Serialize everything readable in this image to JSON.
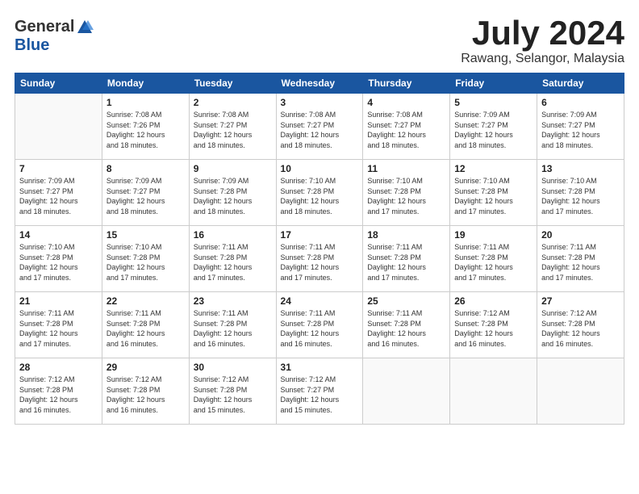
{
  "logo": {
    "general": "General",
    "blue": "Blue"
  },
  "title": "July 2024",
  "location": "Rawang, Selangor, Malaysia",
  "headers": [
    "Sunday",
    "Monday",
    "Tuesday",
    "Wednesday",
    "Thursday",
    "Friday",
    "Saturday"
  ],
  "weeks": [
    [
      {
        "day": "",
        "info": ""
      },
      {
        "day": "1",
        "info": "Sunrise: 7:08 AM\nSunset: 7:26 PM\nDaylight: 12 hours\nand 18 minutes."
      },
      {
        "day": "2",
        "info": "Sunrise: 7:08 AM\nSunset: 7:27 PM\nDaylight: 12 hours\nand 18 minutes."
      },
      {
        "day": "3",
        "info": "Sunrise: 7:08 AM\nSunset: 7:27 PM\nDaylight: 12 hours\nand 18 minutes."
      },
      {
        "day": "4",
        "info": "Sunrise: 7:08 AM\nSunset: 7:27 PM\nDaylight: 12 hours\nand 18 minutes."
      },
      {
        "day": "5",
        "info": "Sunrise: 7:09 AM\nSunset: 7:27 PM\nDaylight: 12 hours\nand 18 minutes."
      },
      {
        "day": "6",
        "info": "Sunrise: 7:09 AM\nSunset: 7:27 PM\nDaylight: 12 hours\nand 18 minutes."
      }
    ],
    [
      {
        "day": "7",
        "info": "Sunrise: 7:09 AM\nSunset: 7:27 PM\nDaylight: 12 hours\nand 18 minutes."
      },
      {
        "day": "8",
        "info": "Sunrise: 7:09 AM\nSunset: 7:27 PM\nDaylight: 12 hours\nand 18 minutes."
      },
      {
        "day": "9",
        "info": "Sunrise: 7:09 AM\nSunset: 7:28 PM\nDaylight: 12 hours\nand 18 minutes."
      },
      {
        "day": "10",
        "info": "Sunrise: 7:10 AM\nSunset: 7:28 PM\nDaylight: 12 hours\nand 18 minutes."
      },
      {
        "day": "11",
        "info": "Sunrise: 7:10 AM\nSunset: 7:28 PM\nDaylight: 12 hours\nand 17 minutes."
      },
      {
        "day": "12",
        "info": "Sunrise: 7:10 AM\nSunset: 7:28 PM\nDaylight: 12 hours\nand 17 minutes."
      },
      {
        "day": "13",
        "info": "Sunrise: 7:10 AM\nSunset: 7:28 PM\nDaylight: 12 hours\nand 17 minutes."
      }
    ],
    [
      {
        "day": "14",
        "info": "Sunrise: 7:10 AM\nSunset: 7:28 PM\nDaylight: 12 hours\nand 17 minutes."
      },
      {
        "day": "15",
        "info": "Sunrise: 7:10 AM\nSunset: 7:28 PM\nDaylight: 12 hours\nand 17 minutes."
      },
      {
        "day": "16",
        "info": "Sunrise: 7:11 AM\nSunset: 7:28 PM\nDaylight: 12 hours\nand 17 minutes."
      },
      {
        "day": "17",
        "info": "Sunrise: 7:11 AM\nSunset: 7:28 PM\nDaylight: 12 hours\nand 17 minutes."
      },
      {
        "day": "18",
        "info": "Sunrise: 7:11 AM\nSunset: 7:28 PM\nDaylight: 12 hours\nand 17 minutes."
      },
      {
        "day": "19",
        "info": "Sunrise: 7:11 AM\nSunset: 7:28 PM\nDaylight: 12 hours\nand 17 minutes."
      },
      {
        "day": "20",
        "info": "Sunrise: 7:11 AM\nSunset: 7:28 PM\nDaylight: 12 hours\nand 17 minutes."
      }
    ],
    [
      {
        "day": "21",
        "info": "Sunrise: 7:11 AM\nSunset: 7:28 PM\nDaylight: 12 hours\nand 17 minutes."
      },
      {
        "day": "22",
        "info": "Sunrise: 7:11 AM\nSunset: 7:28 PM\nDaylight: 12 hours\nand 16 minutes."
      },
      {
        "day": "23",
        "info": "Sunrise: 7:11 AM\nSunset: 7:28 PM\nDaylight: 12 hours\nand 16 minutes."
      },
      {
        "day": "24",
        "info": "Sunrise: 7:11 AM\nSunset: 7:28 PM\nDaylight: 12 hours\nand 16 minutes."
      },
      {
        "day": "25",
        "info": "Sunrise: 7:11 AM\nSunset: 7:28 PM\nDaylight: 12 hours\nand 16 minutes."
      },
      {
        "day": "26",
        "info": "Sunrise: 7:12 AM\nSunset: 7:28 PM\nDaylight: 12 hours\nand 16 minutes."
      },
      {
        "day": "27",
        "info": "Sunrise: 7:12 AM\nSunset: 7:28 PM\nDaylight: 12 hours\nand 16 minutes."
      }
    ],
    [
      {
        "day": "28",
        "info": "Sunrise: 7:12 AM\nSunset: 7:28 PM\nDaylight: 12 hours\nand 16 minutes."
      },
      {
        "day": "29",
        "info": "Sunrise: 7:12 AM\nSunset: 7:28 PM\nDaylight: 12 hours\nand 16 minutes."
      },
      {
        "day": "30",
        "info": "Sunrise: 7:12 AM\nSunset: 7:28 PM\nDaylight: 12 hours\nand 15 minutes."
      },
      {
        "day": "31",
        "info": "Sunrise: 7:12 AM\nSunset: 7:27 PM\nDaylight: 12 hours\nand 15 minutes."
      },
      {
        "day": "",
        "info": ""
      },
      {
        "day": "",
        "info": ""
      },
      {
        "day": "",
        "info": ""
      }
    ]
  ]
}
